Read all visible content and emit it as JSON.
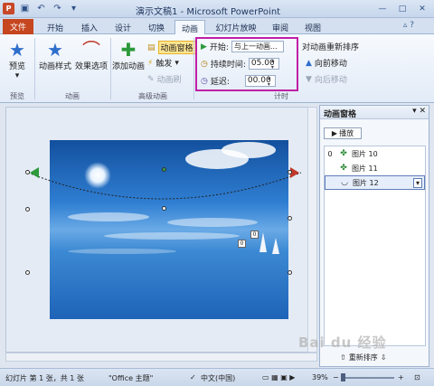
{
  "window": {
    "title": "演示文稿1 - Microsoft PowerPoint",
    "app_badge": "P",
    "controls": [
      "—",
      "□",
      "✕"
    ]
  },
  "tabs": [
    {
      "label": "文件"
    },
    {
      "label": "开始"
    },
    {
      "label": "插入"
    },
    {
      "label": "设计"
    },
    {
      "label": "切换"
    },
    {
      "label": "动画"
    },
    {
      "label": "幻灯片放映"
    },
    {
      "label": "审阅"
    },
    {
      "label": "视图"
    }
  ],
  "ribbon": {
    "preview": {
      "button": "预览",
      "group": "预览"
    },
    "animation": {
      "styles": "动画样式",
      "effects": "效果选项",
      "group": "动画"
    },
    "advanced": {
      "add": "添加动画",
      "pane_btn": "动画窗格",
      "trigger": "触发",
      "painter": "动画刷",
      "group": "高级动画"
    },
    "timing": {
      "start_label": "开始:",
      "start_value": "与上一动画...",
      "duration_label": "持续时间:",
      "duration_value": "05.00",
      "delay_label": "延迟:",
      "delay_value": "00.00",
      "reorder_title": "对动画重新排序",
      "move_earlier": "向前移动",
      "move_later": "向后移动",
      "group": "计时"
    }
  },
  "slide": {
    "marker_a": "0",
    "marker_b": "0"
  },
  "pane": {
    "title": "动画窗格",
    "play": "播放",
    "items": [
      {
        "num": "0",
        "label": "图片 10"
      },
      {
        "num": "",
        "label": "图片 11"
      },
      {
        "num": "",
        "label": "图片 12"
      }
    ],
    "reorder": "重新排序"
  },
  "status": {
    "slide_info": "幻灯片 第 1 张，共 1 张",
    "theme": "\"Office 主题\"",
    "language": "中文(中国)",
    "zoom": "39%"
  },
  "watermark": "Bai du 经验"
}
